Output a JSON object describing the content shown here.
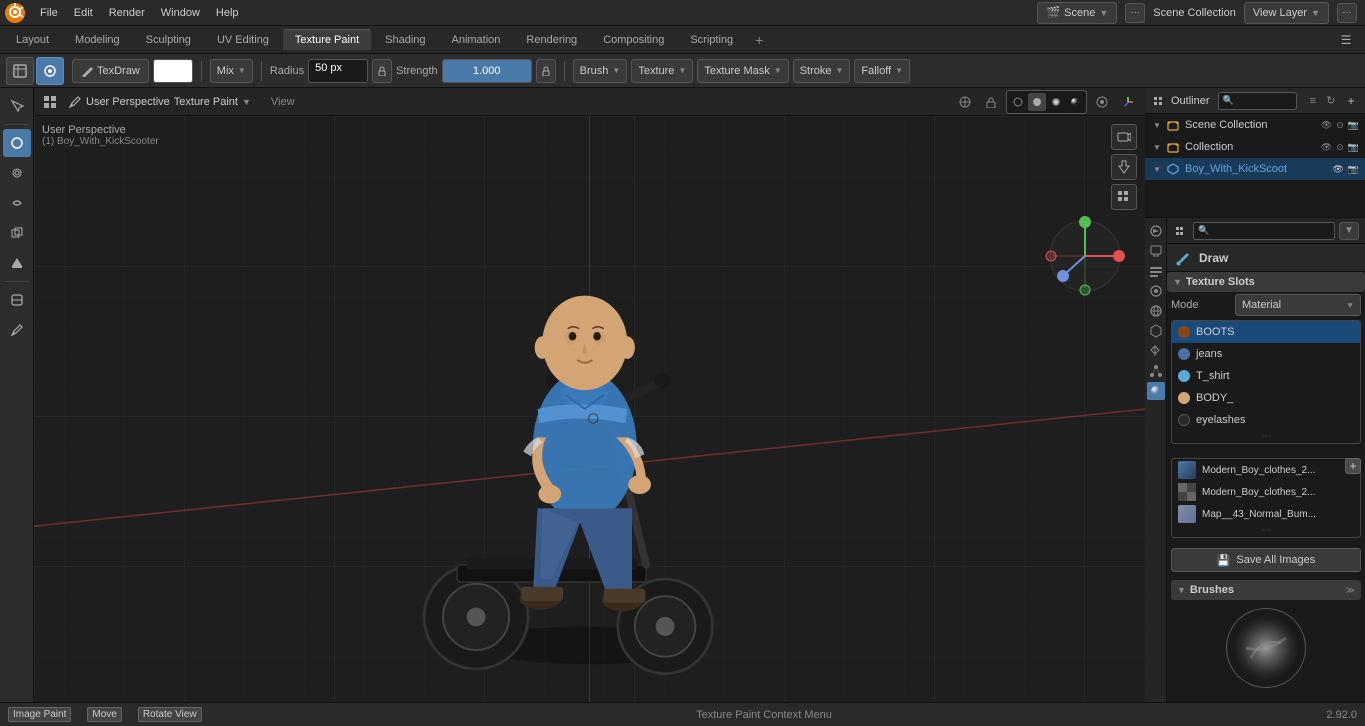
{
  "app": {
    "title": "Blender",
    "version": "2.92.0"
  },
  "menu": {
    "items": [
      "File",
      "Edit",
      "Render",
      "Window",
      "Help"
    ]
  },
  "workspace_tabs": {
    "tabs": [
      "Layout",
      "Modeling",
      "Sculpting",
      "UV Editing",
      "Texture Paint",
      "Shading",
      "Animation",
      "Rendering",
      "Compositing",
      "Scripting"
    ],
    "active": "Texture Paint",
    "plus": "+"
  },
  "toolbar": {
    "mode_label": "TexDraw",
    "blend_mode": "Mix",
    "radius_label": "Radius",
    "radius_value": "50 px",
    "strength_label": "Strength",
    "strength_value": "1.000",
    "brush_label": "Brush",
    "texture_label": "Texture",
    "texture_mask_label": "Texture Mask",
    "stroke_label": "Stroke",
    "falloff_label": "Falloff"
  },
  "viewport": {
    "title": "User Perspective",
    "subtitle": "(1) Boy_With_KickScooter",
    "paint_context_menu": "Texture Paint Context Menu",
    "context_menu_hint": "Texture Paint"
  },
  "status_bar": {
    "items": [
      {
        "key": "Image Paint",
        "description": ""
      },
      {
        "key": "Move",
        "description": ""
      },
      {
        "key": "Rotate View",
        "description": ""
      }
    ],
    "context": "Texture Paint Context Menu",
    "version": "2.92.0"
  },
  "outliner": {
    "scene_collection": "Scene Collection",
    "collection": "Collection",
    "object": "Boy_With_KickScoot",
    "search_placeholder": "Search"
  },
  "properties": {
    "draw_label": "Draw",
    "texture_slots_header": "Texture Slots",
    "mode_label": "Mode",
    "mode_value": "Material",
    "slots": [
      {
        "name": "BOOTS",
        "color": "#8B4513",
        "active": true
      },
      {
        "name": "jeans",
        "color": "#4a6fa0"
      },
      {
        "name": "T_shirt",
        "color": "#5ba8d9"
      },
      {
        "name": "BODY_",
        "color": "#d4a574"
      },
      {
        "name": "eyelashes",
        "color": "#2a2a2a"
      }
    ],
    "images": [
      {
        "name": "Modern_Boy_clothes_2...",
        "type": "gradient"
      },
      {
        "name": "Modern_Boy_clothes_2...",
        "type": "checker"
      },
      {
        "name": "Map__43_Normal_Bum...",
        "type": "normal"
      }
    ],
    "save_all_images": "Save All Images",
    "brushes_header": "Brushes"
  },
  "icons": {
    "search": "🔍",
    "draw_brush": "✏",
    "collection": "📁",
    "mesh": "◻",
    "eye": "👁",
    "camera": "📷",
    "gear": "⚙",
    "plus": "+",
    "minus": "−",
    "arrow_down": "▼",
    "arrow_right": "▶",
    "checkmark": "✓",
    "expand": "≫",
    "dots": "⋯",
    "filter": "≡",
    "pin": "📌"
  }
}
